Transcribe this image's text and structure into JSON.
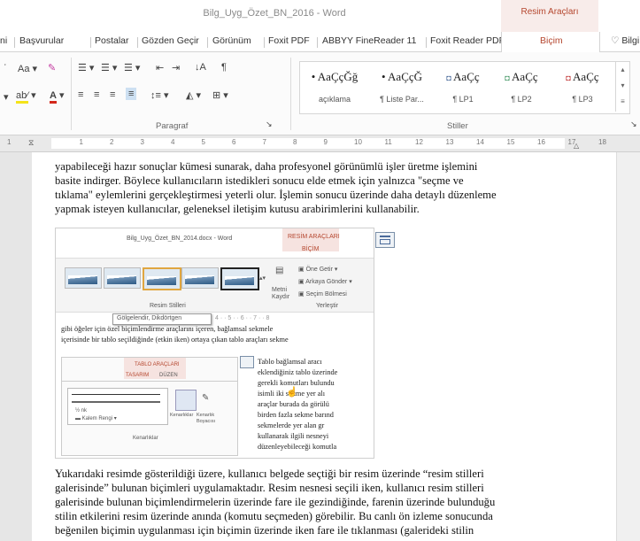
{
  "window": {
    "title": "Bilg_Uyg_Özet_BN_2016 - Word",
    "context_group": "Resim Araçları"
  },
  "tabs": [
    "ni",
    "Başvurular",
    "Postalar",
    "Gözden Geçir",
    "Görünüm",
    "Foxit PDF",
    "ABBYY FineReader 11",
    "Foxit Reader PDF",
    "Biçim",
    "Bilgi"
  ],
  "ribbon": {
    "font_size_label": "Aa",
    "paragraph_group": "Paragraf",
    "styles_group": "Stiller",
    "sort_icon": "sort-az-icon",
    "pilcrow": "¶",
    "styles": [
      {
        "sample": "• AaÇçĞğ",
        "name": "açıklama"
      },
      {
        "sample": "• AaÇçĞ",
        "name": "¶ Liste Par..."
      },
      {
        "sample": "AaÇç",
        "name": "¶ LP1"
      },
      {
        "sample": "AaÇç",
        "name": "¶ LP2"
      },
      {
        "sample": "AaÇç",
        "name": "¶ LP3"
      }
    ]
  },
  "ruler": {
    "numbers": [
      "1",
      "1",
      "2",
      "3",
      "4",
      "5",
      "6",
      "7",
      "8",
      "9",
      "10",
      "11",
      "12",
      "13",
      "14",
      "15",
      "16",
      "17",
      "18"
    ]
  },
  "document": {
    "para1": [
      "yapabileceği hazır sonuçlar kümesi sunarak, daha profesyonel görünümlü işler üretme işlemini",
      "basite indirger. Böylece kullanıcıların istedikleri sonucu elde etmek için yalnızca \"seçme ve",
      "tıklama\" eylemlerini gerçekleştirmesi yeterli olur. İşlemin sonucu üzerinde daha detaylı düzenleme",
      "yapmak isteyen kullanıcılar, geleneksel iletişim kutusu arabirimlerini kullanabilir."
    ],
    "para2": [
      "Yukarıdaki resimde gösterildiği üzere, kullanıcı belgede seçtiği bir resim üzerinde “resim stilleri",
      "galerisinde” bulunan biçimleri uygulamaktadır. Resim nesnesi seçili iken, kullanıcı resim stilleri",
      "galerisinde bulunan biçimlendirmelerin üzerinde fare ile gezindiğinde, farenin üzerinde bulunduğu",
      "stilin etkilerini resim üzerinde anında (komutu seçmeden) görebilir. Bu canlı ön izleme sonucunda",
      "beğenilen biçimin uygulanması için biçimin üzerinde iken fare ile tıklanması (galerideki stilin"
    ]
  },
  "embedded": {
    "title": "Bilg_Uyg_Özet_BN_2014.docx - Word",
    "context": "RESİM ARAÇLARI",
    "tab": "BİÇİM",
    "bring_forward": "Öne Getir",
    "send_backward": "Arkaya Gönder",
    "selection_pane": "Seçim Bölmesi",
    "wrap_text": "Metni Kaydır",
    "styles_label": "Resim Stilleri",
    "arrange_label": "Yerleştir",
    "tooltip": "Gölgelendir, Dikdörtgen",
    "lines_top": [
      "gibi öğeler için özel biçimlendirme araçlarını içeren, bağlamsal sekmele",
      "içerisinde bir tablo seçildiğinde (etkin iken) ortaya çıkan tablo araçları sekme"
    ],
    "inner": {
      "context": "TABLO ARAÇLARI",
      "tab1": "TASARIM",
      "tab2": "DÜZEN",
      "pen_size": "½ nk",
      "pen_color": "Kalem Rengi",
      "borders": "Kenarlıklar",
      "border_painter": "Kenarlık Boyacısı",
      "group": "Kenarlıklar"
    },
    "lines_right": [
      "Tablo bağlamsal aracı",
      "eklendiğiniz tablo üzerinde",
      "gerekli komutları bulundu",
      "isimli iki sekme yer alı",
      "araçlar burada da görülü",
      "birden fazla sekme barınd",
      "sekmelerde yer alan gr",
      "kullanarak ilgili nesneyi",
      "düzenleyebileceği komutla"
    ]
  }
}
